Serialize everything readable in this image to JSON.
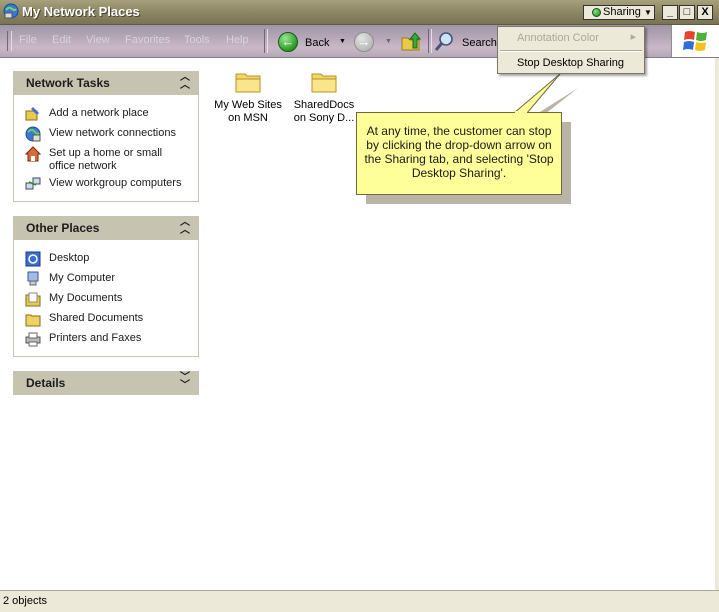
{
  "window": {
    "title": "My Network Places"
  },
  "sharing": {
    "label": "Sharing"
  },
  "window_controls": {
    "minimize": "_",
    "maximize": "□",
    "close": "X"
  },
  "menubar": [
    "File",
    "Edit",
    "View",
    "Favorites",
    "Tools",
    "Help"
  ],
  "toolbar": {
    "back_label": "Back",
    "search_label": "Search"
  },
  "context_menu": {
    "items": [
      {
        "label": "Annotation Color",
        "disabled": true,
        "has_submenu": true
      },
      {
        "label": "Stop Desktop Sharing",
        "disabled": false
      }
    ]
  },
  "network_tasks": {
    "title": "Network Tasks",
    "items": [
      {
        "label": "Add a network place",
        "icon": "add-network-place-icon"
      },
      {
        "label": "View network connections",
        "icon": "network-connections-icon"
      },
      {
        "label": "Set up a home or small office network",
        "icon": "home-network-icon"
      },
      {
        "label": "View workgroup computers",
        "icon": "workgroup-computers-icon"
      }
    ]
  },
  "other_places": {
    "title": "Other Places",
    "items": [
      {
        "label": "Desktop",
        "icon": "desktop-icon"
      },
      {
        "label": "My Computer",
        "icon": "my-computer-icon"
      },
      {
        "label": "My Documents",
        "icon": "my-documents-icon"
      },
      {
        "label": "Shared Documents",
        "icon": "shared-documents-icon"
      },
      {
        "label": "Printers and Faxes",
        "icon": "printer-icon"
      }
    ]
  },
  "details": {
    "title": "Details"
  },
  "files": [
    {
      "line1": "My Web Sites",
      "line2": "on MSN"
    },
    {
      "line1": "SharedDocs",
      "line2": "on Sony D..."
    }
  ],
  "callout": {
    "text": "At any time, the customer can stop by clicking the drop-down arrow on the Sharing tab, and selecting 'Stop Desktop Sharing'."
  },
  "status": {
    "text": "2 objects"
  },
  "colors": {
    "callout_bg": "#ffff99",
    "panel_header": "#c6c3b1",
    "titlebar": "#8a8462"
  }
}
